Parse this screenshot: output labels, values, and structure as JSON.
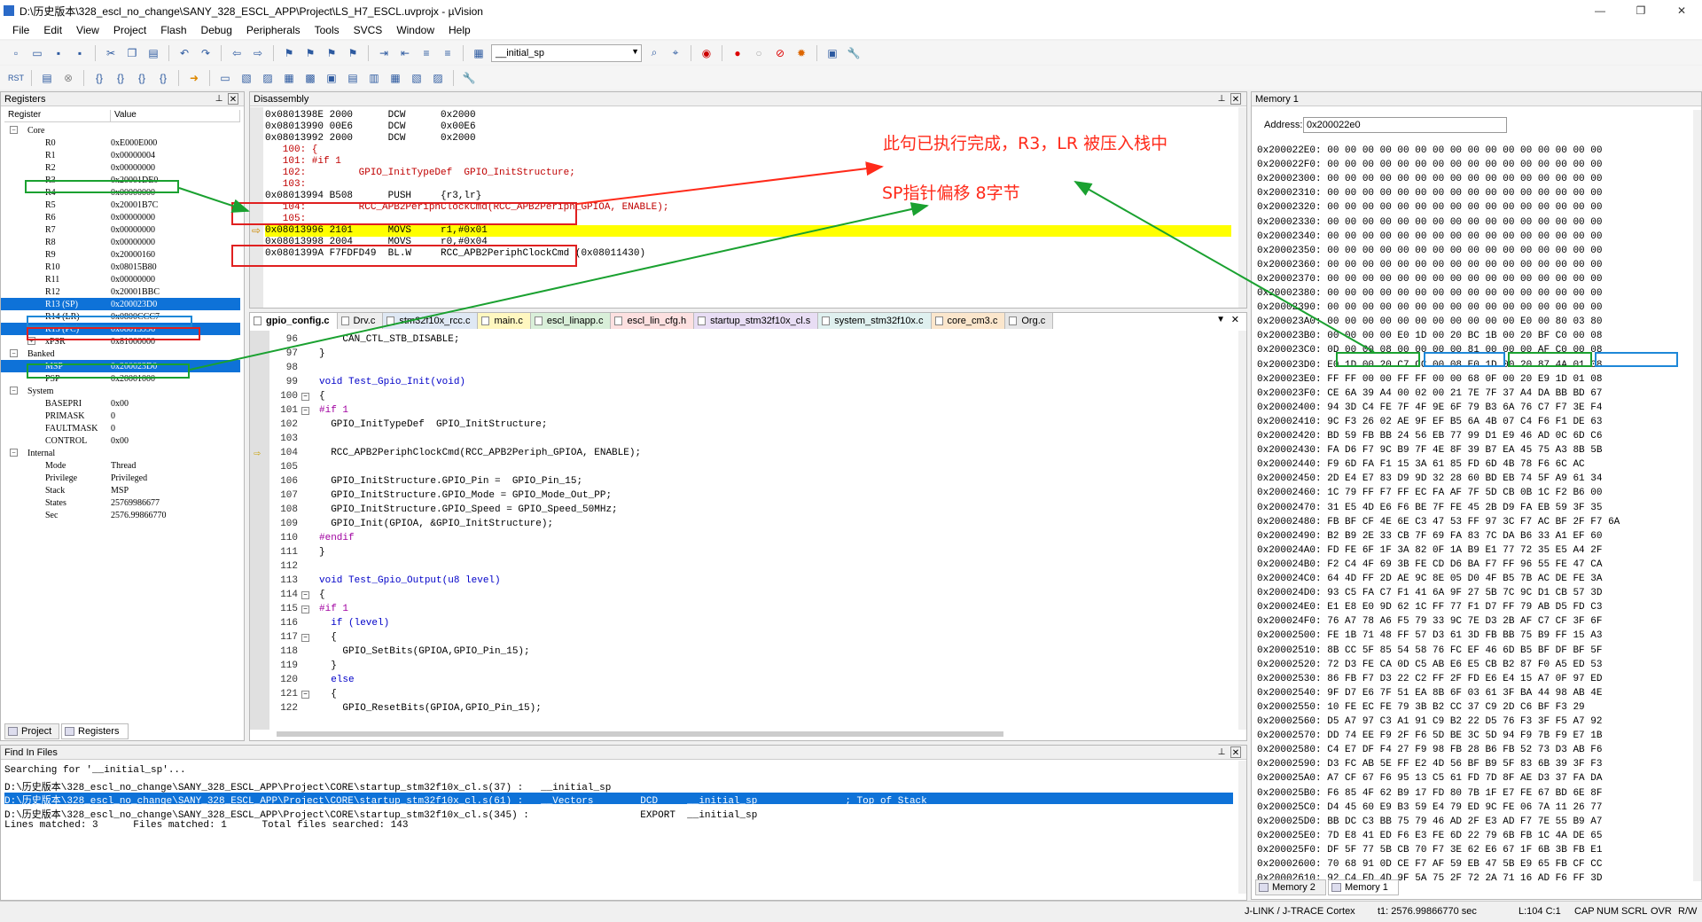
{
  "window": {
    "title": "D:\\历史版本\\328_escl_no_change\\SANY_328_ESCL_APP\\Project\\LS_H7_ESCL.uvprojx - µVision",
    "min": "—",
    "max": "❐",
    "close": "✕"
  },
  "menu": [
    "File",
    "Edit",
    "View",
    "Project",
    "Flash",
    "Debug",
    "Peripherals",
    "Tools",
    "SVCS",
    "Window",
    "Help"
  ],
  "toolbar": {
    "target_combo": "__initial_sp"
  },
  "registers": {
    "title": "Registers",
    "col_register": "Register",
    "col_value": "Value",
    "groups": [
      {
        "name": "Core",
        "rows": [
          {
            "n": "R0",
            "v": "0xE000E000"
          },
          {
            "n": "R1",
            "v": "0x00000004"
          },
          {
            "n": "R2",
            "v": "0x00000000"
          },
          {
            "n": "R3",
            "v": "0x20001DE0"
          },
          {
            "n": "R4",
            "v": "0x00000000"
          },
          {
            "n": "R5",
            "v": "0x20001B7C"
          },
          {
            "n": "R6",
            "v": "0x00000000"
          },
          {
            "n": "R7",
            "v": "0x00000000"
          },
          {
            "n": "R8",
            "v": "0x00000000"
          },
          {
            "n": "R9",
            "v": "0x20000160"
          },
          {
            "n": "R10",
            "v": "0x08015B80"
          },
          {
            "n": "R11",
            "v": "0x00000000"
          },
          {
            "n": "R12",
            "v": "0x20001BBC"
          },
          {
            "n": "R13 (SP)",
            "v": "0x200023D0"
          },
          {
            "n": "R14 (LR)",
            "v": "0x0800CCC7"
          },
          {
            "n": "R15 (PC)",
            "v": "0x08013996"
          },
          {
            "n": "xPSR",
            "v": "0x81000000"
          }
        ]
      },
      {
        "name": "Banked",
        "rows": [
          {
            "n": "MSP",
            "v": "0x200023D0"
          },
          {
            "n": "PSP",
            "v": "0x20001000"
          }
        ]
      },
      {
        "name": "System",
        "rows": [
          {
            "n": "BASEPRI",
            "v": "0x00"
          },
          {
            "n": "PRIMASK",
            "v": "0"
          },
          {
            "n": "FAULTMASK",
            "v": "0"
          },
          {
            "n": "CONTROL",
            "v": "0x00"
          }
        ]
      },
      {
        "name": "Internal",
        "rows": [
          {
            "n": "Mode",
            "v": "Thread"
          },
          {
            "n": "Privilege",
            "v": "Privileged"
          },
          {
            "n": "Stack",
            "v": "MSP"
          },
          {
            "n": "States",
            "v": "25769986677"
          },
          {
            "n": "Sec",
            "v": "2576.99866770"
          }
        ]
      }
    ],
    "tab_project": "Project",
    "tab_registers": "Registers"
  },
  "disasm": {
    "title": "Disassembly",
    "lines": [
      {
        "t": "asm",
        "s": "0x0801398E 2000      DCW      0x2000"
      },
      {
        "t": "asm",
        "s": "0x08013990 00E6      DCW      0x00E6"
      },
      {
        "t": "asm",
        "s": "0x08013992 2000      DCW      0x2000"
      },
      {
        "t": "src",
        "s": "   100: {"
      },
      {
        "t": "src",
        "s": "   101: #if 1"
      },
      {
        "t": "src",
        "s": "   102:         GPIO_InitTypeDef  GPIO_InitStructure;"
      },
      {
        "t": "src",
        "s": "   103: "
      },
      {
        "t": "asm",
        "s": "0x08013994 B508      PUSH     {r3,lr}"
      },
      {
        "t": "src",
        "s": "   104:         RCC_APB2PeriphClockCmd(RCC_APB2Periph_GPIOA, ENABLE);"
      },
      {
        "t": "src",
        "s": "   105: "
      },
      {
        "t": "asm",
        "s": "0x08013996 2101      MOVS     r1,#0x01"
      },
      {
        "t": "asm",
        "s": "0x08013998 2004      MOVS     r0,#0x04"
      },
      {
        "t": "asm",
        "s": "0x0801399A F7FDFD49  BL.W     RCC_APB2PeriphClockCmd (0x08011430)"
      }
    ]
  },
  "annotations": {
    "a1": "此句已执行完成，R3，LR 被压入栈中",
    "a2": "SP指针偏移 8字节"
  },
  "editor": {
    "tabs": [
      "gpio_config.c",
      "Drv.c",
      "stm32f10x_rcc.c",
      "main.c",
      "escl_linapp.c",
      "escl_lin_cfg.h",
      "startup_stm32f10x_cl.s",
      "system_stm32f10x.c",
      "core_cm3.c",
      "Org.c"
    ],
    "lines": [
      {
        "n": "96",
        "c": "    CAN_CTL_STB_DISABLE;"
      },
      {
        "n": "97",
        "c": "}"
      },
      {
        "n": "98",
        "c": ""
      },
      {
        "n": "99",
        "c": "void Test_Gpio_Init(void)"
      },
      {
        "n": "100",
        "c": "{"
      },
      {
        "n": "101",
        "c": "#if 1"
      },
      {
        "n": "102",
        "c": "  GPIO_InitTypeDef  GPIO_InitStructure;"
      },
      {
        "n": "103",
        "c": ""
      },
      {
        "n": "104",
        "c": "  RCC_APB2PeriphClockCmd(RCC_APB2Periph_GPIOA, ENABLE);"
      },
      {
        "n": "105",
        "c": ""
      },
      {
        "n": "106",
        "c": "  GPIO_InitStructure.GPIO_Pin =  GPIO_Pin_15;"
      },
      {
        "n": "107",
        "c": "  GPIO_InitStructure.GPIO_Mode = GPIO_Mode_Out_PP;"
      },
      {
        "n": "108",
        "c": "  GPIO_InitStructure.GPIO_Speed = GPIO_Speed_50MHz;"
      },
      {
        "n": "109",
        "c": "  GPIO_Init(GPIOA, &GPIO_InitStructure);"
      },
      {
        "n": "110",
        "c": "#endif"
      },
      {
        "n": "111",
        "c": "}"
      },
      {
        "n": "112",
        "c": ""
      },
      {
        "n": "113",
        "c": "void Test_Gpio_Output(u8 level)"
      },
      {
        "n": "114",
        "c": "{"
      },
      {
        "n": "115",
        "c": "#if 1"
      },
      {
        "n": "116",
        "c": "  if (level)"
      },
      {
        "n": "117",
        "c": "  {"
      },
      {
        "n": "118",
        "c": "    GPIO_SetBits(GPIOA,GPIO_Pin_15);"
      },
      {
        "n": "119",
        "c": "  }"
      },
      {
        "n": "120",
        "c": "  else"
      },
      {
        "n": "121",
        "c": "  {"
      },
      {
        "n": "122",
        "c": "    GPIO_ResetBits(GPIOA,GPIO_Pin_15);"
      }
    ]
  },
  "memory": {
    "title": "Memory 1",
    "address_label": "Address:",
    "address_value": "0x200022e0",
    "rows": [
      "0x200022E0: 00 00 00 00 00 00 00 00 00 00 00 00 00 00 00 00",
      "0x200022F0: 00 00 00 00 00 00 00 00 00 00 00 00 00 00 00 00",
      "0x20002300: 00 00 00 00 00 00 00 00 00 00 00 00 00 00 00 00",
      "0x20002310: 00 00 00 00 00 00 00 00 00 00 00 00 00 00 00 00",
      "0x20002320: 00 00 00 00 00 00 00 00 00 00 00 00 00 00 00 00",
      "0x20002330: 00 00 00 00 00 00 00 00 00 00 00 00 00 00 00 00",
      "0x20002340: 00 00 00 00 00 00 00 00 00 00 00 00 00 00 00 00",
      "0x20002350: 00 00 00 00 00 00 00 00 00 00 00 00 00 00 00 00",
      "0x20002360: 00 00 00 00 00 00 00 00 00 00 00 00 00 00 00 00",
      "0x20002370: 00 00 00 00 00 00 00 00 00 00 00 00 00 00 00 00",
      "0x20002380: 00 00 00 00 00 00 00 00 00 00 00 00 00 00 00 00",
      "0x20002390: 00 00 00 00 00 00 00 00 00 00 00 00 00 00 00 00",
      "0x200023A0: 00 00 00 00 00 00 00 00 00 00 00 E0 00 80 03 80",
      "0x200023B0: 00 00 00 00 E0 1D 00 20 BC 1B 00 20 BF C0 00 08",
      "0x200023C0: 0D 00 00 08 00 00 00 00 81 00 00 00 AF C0 00 08",
      "0x200023D0: E0 1D 00 20 C7 CC 00 08 E0 1D 00 20 87 4A 01 08",
      "0x200023E0: FF FF 00 00 FF FF 00 00 68 0F 00 20 E9 1D 01 08",
      "0x200023F0: CE 6A 39 A4 00 02 00 21 7E 7F 37 A4 DA BB BD 67",
      "0x20002400: 94 3D C4 FE 7F 4F 9E 6F 79 B3 6A 76 C7 F7 3E F4",
      "0x20002410: 9C F3 26 02 AE 9F EF B5 6A 4B 07 C4 F6 F1 DE 63",
      "0x20002420: BD 59 FB BB 24 56 EB 77 99 D1 E9 46 AD 0C 6D C6",
      "0x20002430: FA D6 F7 9C B9 7F 4E 8F 39 B7 EA 45 75 A3 8B 5B",
      "0x20002440: F9 6D FA F1 15 3A 61 85 FD 6D 4B 78 F6 6C AC",
      "0x20002450: 2D E4 E7 83 D9 9D 32 28 60 BD EB 74 5F A9 61 34",
      "0x20002460: 1C 79 FF F7 FF EC FA AF 7F 5D CB 0B 1C F2 B6 00",
      "0x20002470: 31 E5 4D E6 F6 BE 7F FE 45 2B D9 FA EB 59 3F 35",
      "0x20002480: FB BF CF 4E 6E C3 47 53 FF 97 3C F7 AC BF 2F F7 6A",
      "0x20002490: B2 B9 2E 33 CB 7F 69 FA 83 7C DA B6 33 A1 EF 60",
      "0x200024A0: FD FE 6F 1F 3A 82 0F 1A B9 E1 77 72 35 E5 A4 2F",
      "0x200024B0: F2 C4 4F 69 3B FE CD D6 BA F7 FF 96 55 FE 47 CA",
      "0x200024C0: 64 4D FF 2D AE 9C 8E 05 D0 4F B5 7B AC DE FE 3A",
      "0x200024D0: 93 C5 FA C7 F1 41 6A 9F 27 5B 7C 9C D1 CB 57 3D",
      "0x200024E0: E1 E8 E0 9D 62 1C FF 77 F1 D7 FF 79 AB D5 FD C3",
      "0x200024F0: 76 A7 78 A6 F5 79 33 9C 7E D3 2B AF C7 CF 3F 6F",
      "0x20002500: FE 1B 71 48 FF 57 D3 61 3D FB BB 75 B9 FF 15 A3",
      "0x20002510: 8B CC 5F 85 54 58 76 FC EF 46 6D B5 BF DF BF 5F",
      "0x20002520: 72 D3 FE CA 0D C5 AB E6 E5 CB B2 87 F0 A5 ED 53",
      "0x20002530: 86 FB F7 D3 22 C2 FF 2F FD E6 E4 15 A7 0F 97 ED",
      "0x20002540: 9F D7 E6 7F 51 EA 8B 6F 03 61 3F BA 44 98 AB 4E",
      "0x20002550: 10 FE EC FE 79 3B B2 CC 37 C9 2D C6 BF F3 29",
      "0x20002560: D5 A7 97 C3 A1 91 C9 B2 22 D5 76 F3 3F F5 A7 92",
      "0x20002570: DD 74 EE F9 2F F6 5D BE 3C 5D 94 F9 7B F9 E7 1B",
      "0x20002580: C4 E7 DF F4 27 F9 98 FB 28 B6 FB 52 73 D3 AB F6",
      "0x20002590: D3 FC AB 5E FF E2 4D 56 BF B9 5F 83 6B 39 3F F3",
      "0x200025A0: A7 CF 67 F6 95 13 C5 61 FD 7D 8F AE D3 37 FA DA",
      "0x200025B0: F6 85 4F 62 B9 17 FD 80 7B 1F E7 FE 67 BD 6E 8F",
      "0x200025C0: D4 45 60 E9 B3 59 E4 79 ED 9C FE 06 7A 11 26 77",
      "0x200025D0: BB DC C3 BB 75 79 46 AD 2F E3 AD F7 7E 55 B9 A7",
      "0x200025E0: 7D E8 41 ED F6 E3 FE 6D 22 79 6B FB 1C 4A DE 65",
      "0x200025F0: DF 5F 77 5B CB 70 F7 3E 62 E6 67 1F 6B 3B FB E1",
      "0x20002600: 70 68 91 0D CE F7 AF 59 EB 47 5B E9 65 FB CF CC",
      "0x20002610: 92 C4 FD 4D 9F 5A 75 2F 72 2A 71 16 AD F6 FF 3D"
    ],
    "tab_memory2": "Memory 2",
    "tab_memory1": "Memory 1"
  },
  "find": {
    "title": "Find In Files",
    "lines": [
      "Searching for '__initial_sp'...",
      "D:\\历史版本\\328_escl_no_change\\SANY_328_ESCL_APP\\Project\\CORE\\startup_stm32f10x_cl.s(37) :   __initial_sp",
      "D:\\历史版本\\328_escl_no_change\\SANY_328_ESCL_APP\\Project\\CORE\\startup_stm32f10x_cl.s(61) :   __Vectors        DCD     __initial_sp               ; Top of Stack",
      "D:\\历史版本\\328_escl_no_change\\SANY_328_ESCL_APP\\Project\\CORE\\startup_stm32f10x_cl.s(345) :                   EXPORT  __initial_sp",
      "Lines matched: 3      Files matched: 1      Total files searched: 143"
    ]
  },
  "status": {
    "debugger": "J-LINK / J-TRACE Cortex",
    "time": "t1: 2576.99866770 sec",
    "pos": "L:104 C:1",
    "caps": "CAP",
    "num": "NUM",
    "scrl": "SCRL",
    "ovr": "OVR",
    "rw": "R/W"
  }
}
